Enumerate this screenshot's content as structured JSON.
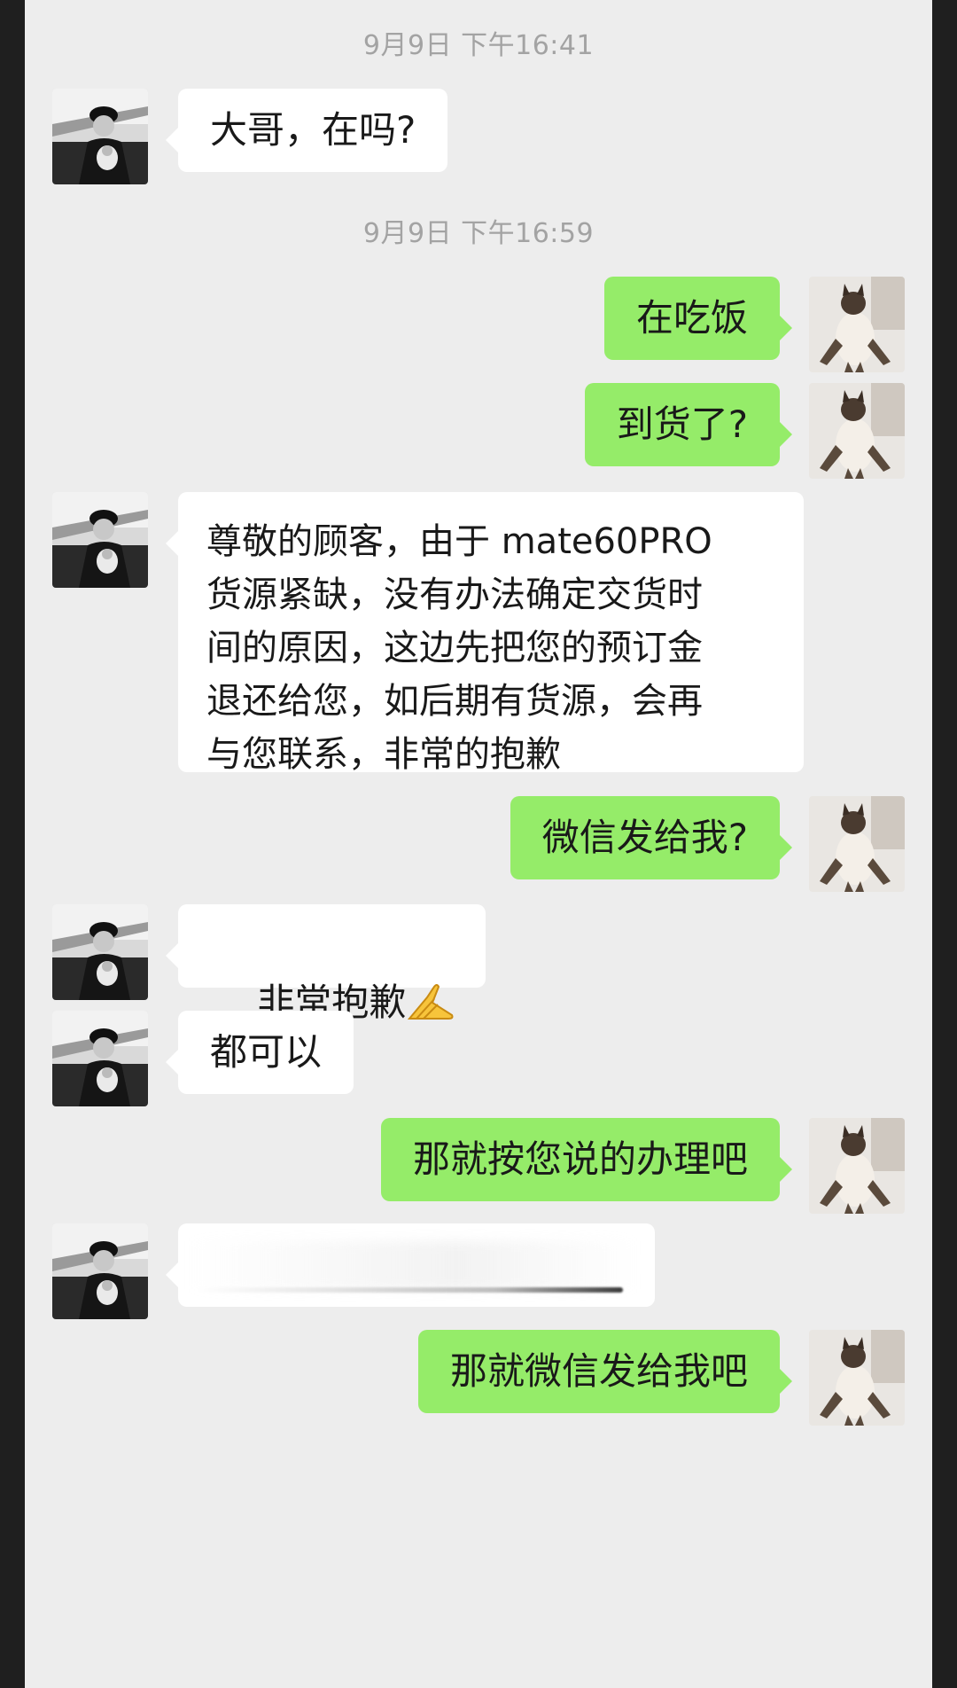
{
  "timestamps": [
    "9月9日 下午16:41",
    "9月9日 下午16:59"
  ],
  "messages": [
    {
      "from": "other",
      "text": "大哥，在吗?"
    },
    {
      "from": "self",
      "text": "在吃饭"
    },
    {
      "from": "self",
      "text": "到货了?"
    },
    {
      "from": "other",
      "text": "尊敬的顾客，由于 mate60PRO\n货源紧缺，没有办法确定交货时\n间的原因，这边先把您的预订金\n退还给您，如后期有货源，会再\n与您联系，非常的抱歉"
    },
    {
      "from": "self",
      "text": "微信发给我?"
    },
    {
      "from": "other",
      "text": "非常抱歉",
      "emoji": "folded-hands-icon"
    },
    {
      "from": "other",
      "text": "都可以"
    },
    {
      "from": "self",
      "text": "那就按您说的办理吧"
    },
    {
      "from": "other",
      "text": "",
      "blurred": true
    },
    {
      "from": "self",
      "text": "那就微信发给我吧"
    }
  ],
  "colors": {
    "background": "#ededed",
    "bubble_self": "#95ec69",
    "bubble_other": "#ffffff",
    "timestamp": "#a3a3a3"
  },
  "avatars": {
    "other": "man-with-cap-avatar",
    "self": "siamese-cat-avatar"
  }
}
